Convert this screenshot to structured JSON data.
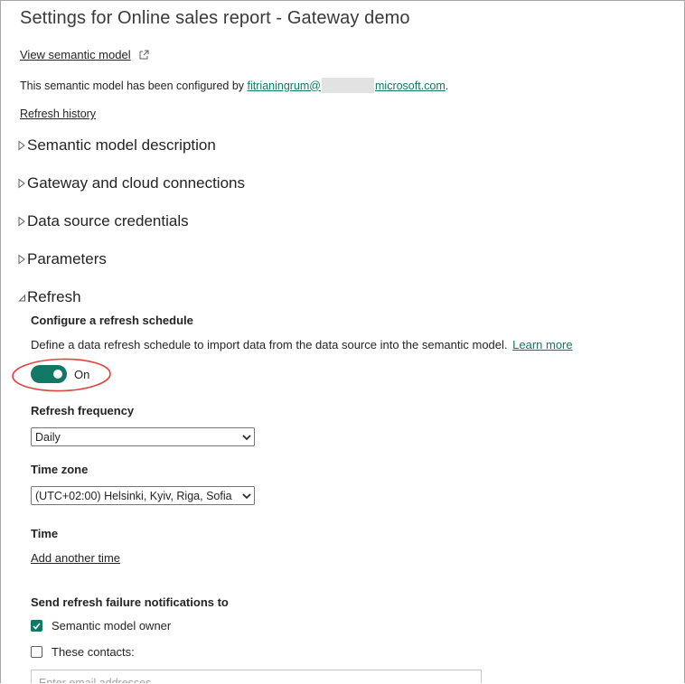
{
  "header": {
    "title": "Settings for Online sales report - Gateway demo"
  },
  "links": {
    "view_semantic_model": "View semantic model",
    "refresh_history": "Refresh history"
  },
  "configured": {
    "prefix": "This semantic model has been configured by ",
    "email_start": "fitrianingrum@",
    "email_end": "microsoft.com",
    "suffix": "."
  },
  "sections": [
    {
      "label": "Semantic model description",
      "expanded": false
    },
    {
      "label": "Gateway and cloud connections",
      "expanded": false
    },
    {
      "label": "Data source credentials",
      "expanded": false
    },
    {
      "label": "Parameters",
      "expanded": false
    },
    {
      "label": "Refresh",
      "expanded": true
    }
  ],
  "refresh": {
    "configure_heading": "Configure a refresh schedule",
    "description": "Define a data refresh schedule to import data from the data source into the semantic model.",
    "learn_more": "Learn more",
    "toggle_state": "On",
    "toggle_on": true,
    "frequency_label": "Refresh frequency",
    "frequency_value": "Daily",
    "timezone_label": "Time zone",
    "timezone_value": "(UTC+02:00) Helsinki, Kyiv, Riga, Sofia",
    "time_label": "Time",
    "add_time": "Add another time",
    "notify_heading": "Send refresh failure notifications to",
    "notify_owner": "Semantic model owner",
    "notify_owner_checked": true,
    "notify_contacts": "These contacts:",
    "notify_contacts_checked": false,
    "email_placeholder": "Enter email addresses"
  },
  "colors": {
    "accent": "#117865",
    "annotation": "#e0443e",
    "text": "#252423"
  },
  "icons": {
    "external": "open-in-new-icon",
    "collapsed": "triangle-right-icon",
    "expanded": "triangle-down-right-icon",
    "select": "chevron-down-icon",
    "check": "checkmark-icon"
  }
}
